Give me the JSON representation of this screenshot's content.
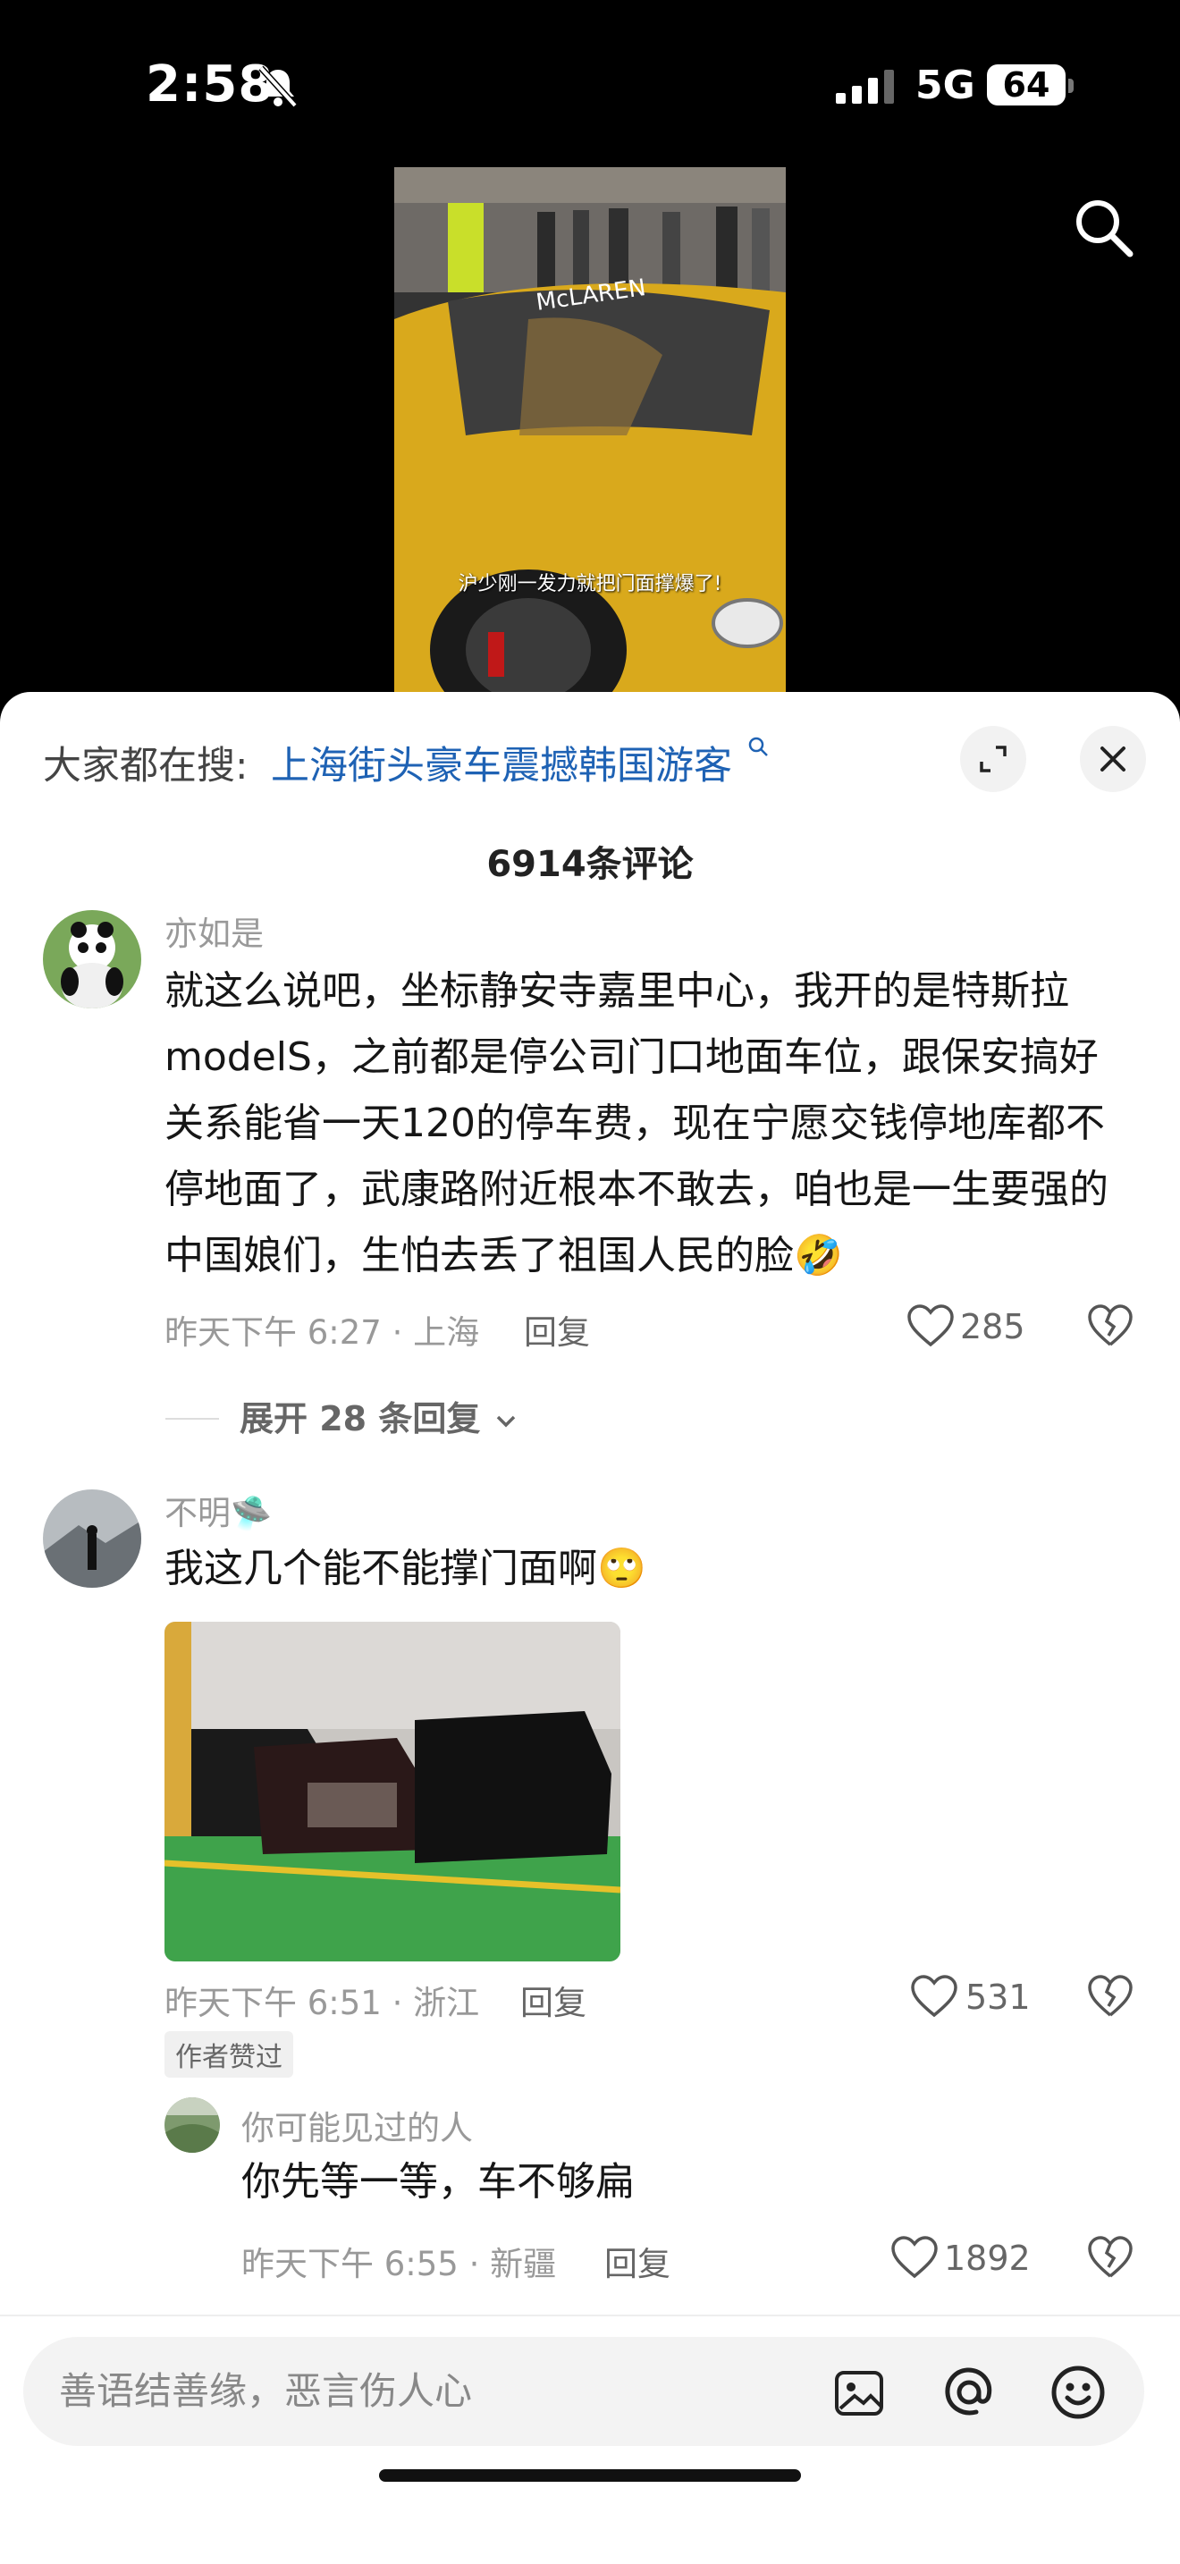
{
  "status_bar": {
    "time": "2:58",
    "network": "5G",
    "battery": "64"
  },
  "video": {
    "caption": "沪少刚一发力就把门面撑爆了!"
  },
  "comments_panel": {
    "search_prefix": "大家都在搜:",
    "search_link": "上海街头豪车震撼韩国游客",
    "count_label": "6914条评论",
    "comments": [
      {
        "username": "亦如是",
        "body_lines": [
          "就这么说吧，坐标静安寺嘉里中心，我开的是特斯拉",
          "modelS，之前都是停公司门口地面车位，跟保安搞好",
          "关系能省一天120的停车费，现在宁愿交钱停地库都不",
          "停地面了，武康路附近根本不敢去，咱也是一生要强的",
          "中国娘们，生怕去丢了祖国人民的脸🤣"
        ],
        "time_location": "昨天下午 6:27 · 上海",
        "reply_label": "回复",
        "likes": "285",
        "expand_replies": "展开 28 条回复"
      },
      {
        "username": "不明🛸",
        "body": "我这几个能不能撑门面啊🙄",
        "time_location": "昨天下午 6:51 · 浙江",
        "reply_label": "回复",
        "likes": "531",
        "badge": "作者赞过",
        "reply": {
          "username": "你可能见过的人",
          "body": "你先等一等，车不够扁",
          "time_location": "昨天下午 6:55 · 新疆",
          "reply_label": "回复",
          "likes": "1892"
        }
      }
    ]
  },
  "input": {
    "placeholder": "善语结善缘，恶言伤人心"
  },
  "colors": {
    "link": "#1e62b4",
    "panel_bg": "#ffffff",
    "input_bg": "#f3f3f3"
  },
  "icons": [
    "bell-slash-icon",
    "signal-icon",
    "search-icon",
    "expand-icon",
    "close-icon",
    "heart-icon",
    "dislike-heart-icon",
    "chevron-down-icon",
    "image-icon",
    "at-icon",
    "emoji-icon"
  ]
}
